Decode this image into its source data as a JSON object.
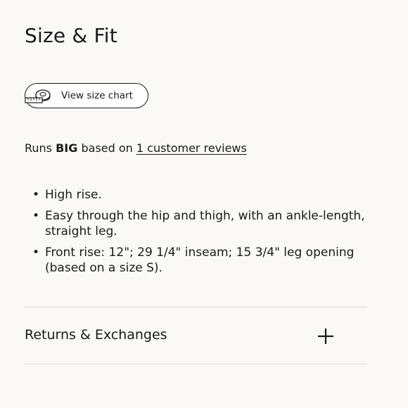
{
  "section": {
    "title": "Size & Fit"
  },
  "size_chart_button": {
    "label": "View size chart",
    "icon": "measuring-tape-icon"
  },
  "fit_summary": {
    "prefix": "Runs",
    "fit_value": "BIG",
    "middle": "based on",
    "reviews_link": "1 customer reviews"
  },
  "details": [
    "High rise.",
    "Easy through the hip and thigh, with an ankle-length, straight leg.",
    "Front rise: 12\"; 29 1/4\" inseam; 15 3/4\" leg opening (based on a size S)."
  ],
  "accordion": {
    "title": "Returns & Exchanges",
    "icon": "plus-icon"
  }
}
